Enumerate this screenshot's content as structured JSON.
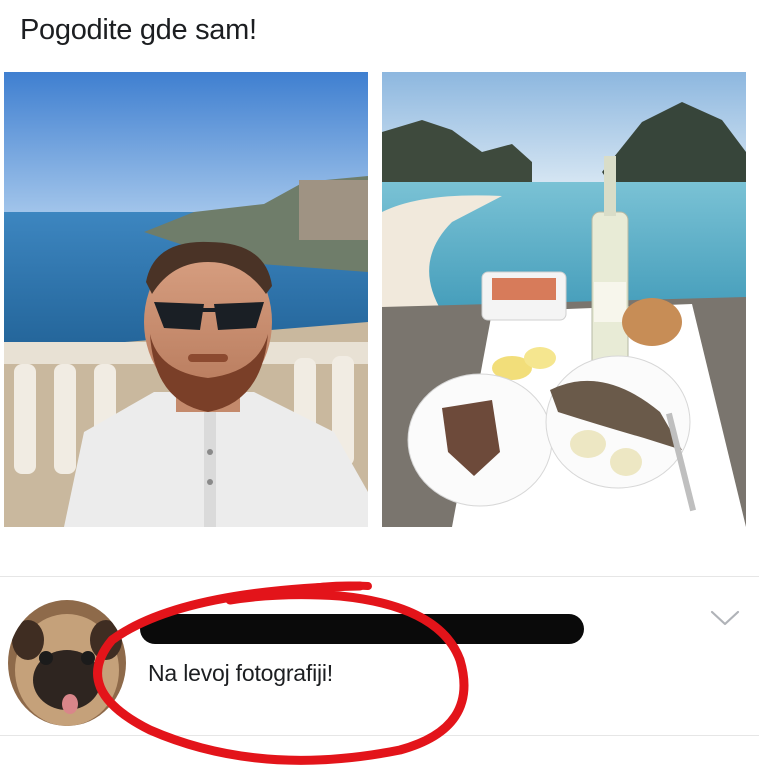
{
  "post": {
    "text": "Pogodite gde sam!"
  },
  "comment": {
    "text": "Na levoj fotografiji!"
  },
  "icons": {
    "expand": "chevron-down-icon"
  },
  "colors": {
    "annotation_circle": "#e3141a",
    "redaction": "#0a0a0a",
    "sky": "#4f8fd8",
    "sea": "#2f7db7"
  }
}
